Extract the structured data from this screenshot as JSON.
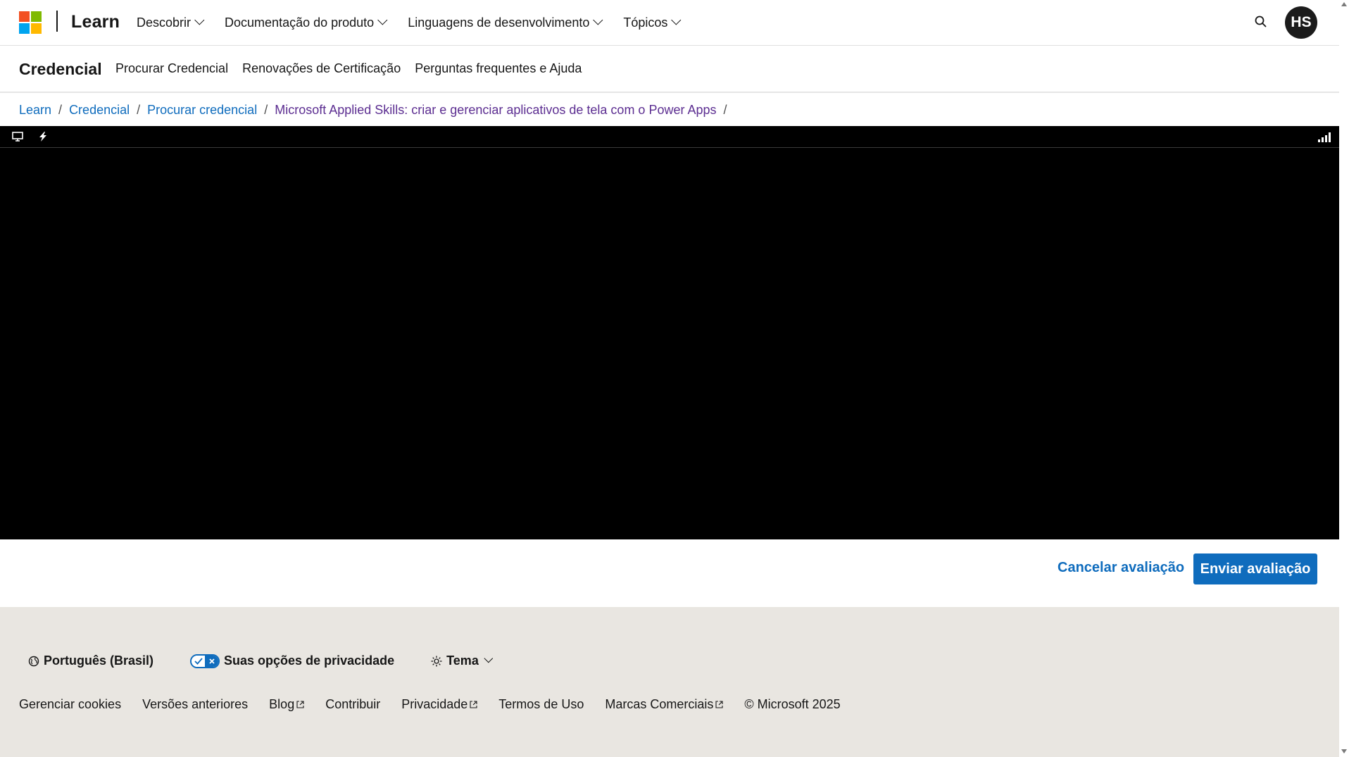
{
  "header": {
    "brand": "Learn",
    "logo_colors": [
      "#f25022",
      "#7fba00",
      "#00a4ef",
      "#ffb900"
    ],
    "nav": [
      {
        "label": "Descobrir"
      },
      {
        "label": "Documentação do produto"
      },
      {
        "label": "Linguagens de desenvolvimento"
      },
      {
        "label": "Tópicos"
      }
    ],
    "search_icon": "search-icon",
    "avatar_initials": "HS"
  },
  "subheader": {
    "title": "Credencial",
    "links": [
      "Procurar Credencial",
      "Renovações de Certificação",
      "Perguntas frequentes e Ajuda"
    ]
  },
  "breadcrumb": [
    "Learn",
    "Credencial",
    "Procurar credencial",
    "Microsoft Applied Skills: criar e gerenciar aplicativos de tela com o Power Apps"
  ],
  "lab": {
    "icons": [
      "monitor-icon",
      "lightning-icon",
      "signal-strength-icon"
    ]
  },
  "actions": {
    "cancel_label": "Cancelar avaliação",
    "submit_label": "Enviar avaliação"
  },
  "footer": {
    "language": "Português (Brasil)",
    "privacy": "Suas opções de privacidade",
    "theme": "Tema",
    "links": [
      "Gerenciar cookies",
      "Versões anteriores",
      "Blog",
      "Contribuir",
      "Privacidade",
      "Termos de Uso",
      "Marcas Comerciais"
    ],
    "copyright": "© Microsoft 2025"
  },
  "colors": {
    "accent": "#0f6cbd",
    "visited_link": "#5c2e91",
    "footer_bg": "#e9e6e1"
  }
}
